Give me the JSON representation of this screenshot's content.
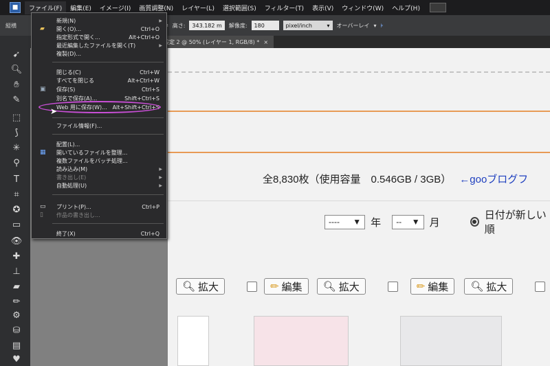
{
  "menubar": {
    "items": [
      "ファイル(F)",
      "編集(E)",
      "イメージ(I)",
      "画質調整(N)",
      "レイヤー(L)",
      "選択範囲(S)",
      "フィルター(T)",
      "表示(V)",
      "ウィンドウ(W)",
      "ヘルプ(H)"
    ]
  },
  "options": {
    "label_left": "縦横",
    "height_label": "高さ:",
    "height_value": "343.182 m",
    "resolution_label": "解像度:",
    "resolution_value": "180",
    "unit": "pixel/inch",
    "overlay": "オーバーレイ"
  },
  "tab": {
    "label": "設定 2 @ 50% (レイヤー 1, RGB/8) *",
    "close": "×"
  },
  "file_menu": {
    "items": [
      {
        "label": "新規(N)",
        "shortcut": ""
      },
      {
        "label": "開く(O)...",
        "shortcut": "Ctrl+O"
      },
      {
        "label": "指定形式で開く...",
        "shortcut": "Alt+Ctrl+O"
      },
      {
        "label": "最近編集したファイルを開く(T)",
        "shortcut": ""
      },
      {
        "label": "複製(D)...",
        "shortcut": ""
      },
      {
        "label": "閉じる(C)",
        "shortcut": "Ctrl+W"
      },
      {
        "label": "すべてを閉じる",
        "shortcut": "Alt+Ctrl+W"
      },
      {
        "label": "保存(S)",
        "shortcut": "Ctrl+S"
      },
      {
        "label": "別名で保存(A)...",
        "shortcut": "Shift+Ctrl+S"
      },
      {
        "label": "Web 用に保存(W)...",
        "shortcut": "Alt+Shift+Ctrl+S"
      },
      {
        "label": "ファイル情報(F)...",
        "shortcut": ""
      },
      {
        "label": "配置(L)...",
        "shortcut": ""
      },
      {
        "label": "開いているファイルを整理...",
        "shortcut": ""
      },
      {
        "label": "複数ファイルをバッチ処理...",
        "shortcut": ""
      },
      {
        "label": "読み込み(M)",
        "shortcut": ""
      },
      {
        "label": "書き出し(E)",
        "shortcut": ""
      },
      {
        "label": "自動処理(U)",
        "shortcut": ""
      },
      {
        "label": "プリント(P)...",
        "shortcut": "Ctrl+P"
      },
      {
        "label": "作品の書き出し...",
        "shortcut": ""
      },
      {
        "label": "終了(X)",
        "shortcut": "Ctrl+Q"
      }
    ]
  },
  "page": {
    "quota": "全8,830枚（使用容量　0.546GB / 3GB）",
    "quota_link": "←gooブログフ",
    "year_select": "----",
    "year_label": "年",
    "month_select": "--",
    "month_label": "月",
    "sort_label": "日付が新しい順",
    "enlarge": "拡大",
    "edit": "編集"
  }
}
